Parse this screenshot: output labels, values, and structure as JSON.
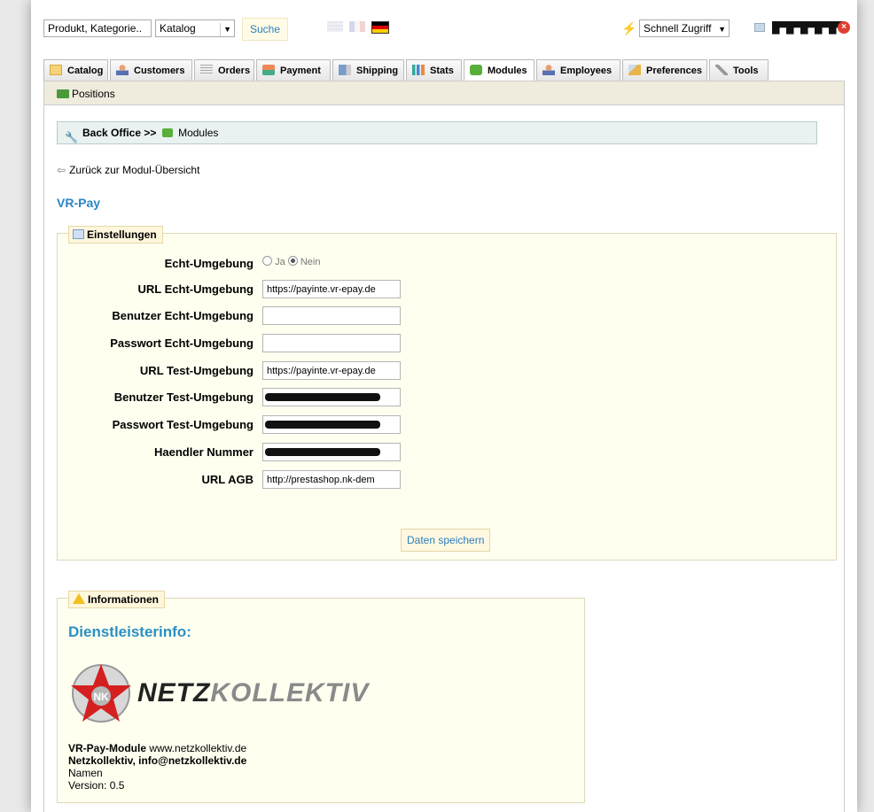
{
  "topbar": {
    "search_value": "Produkt, Kategorie..",
    "category_selected": "Katalog",
    "search_button": "Suche",
    "quick_access": "Schnell Zugriff",
    "flags": [
      "uk-flag",
      "fr-flag",
      "de-flag"
    ]
  },
  "tabs": [
    {
      "label": "Catalog",
      "icon": "folder-icon"
    },
    {
      "label": "Customers",
      "icon": "customers-icon"
    },
    {
      "label": "Orders",
      "icon": "orders-icon"
    },
    {
      "label": "Payment",
      "icon": "payment-icon"
    },
    {
      "label": "Shipping",
      "icon": "truck-icon"
    },
    {
      "label": "Stats",
      "icon": "stats-icon"
    },
    {
      "label": "Modules",
      "icon": "puzzle-icon",
      "active": true
    },
    {
      "label": "Employees",
      "icon": "employees-icon"
    },
    {
      "label": "Preferences",
      "icon": "preferences-icon"
    },
    {
      "label": "Tools",
      "icon": "wrench-icon"
    }
  ],
  "subbar": {
    "positions": "Positions"
  },
  "breadcrumb": {
    "back_office": "Back Office",
    "separator": ">>",
    "current": "Modules"
  },
  "back_link": "Zurück zur Modul-Übersicht",
  "module_title": "VR-Pay",
  "settings": {
    "legend": "Einstellungen",
    "fields": [
      {
        "label": "Echt-Umgebung",
        "type": "radio",
        "options": [
          "Ja",
          "Nein"
        ],
        "selected": "Nein"
      },
      {
        "label": "URL Echt-Umgebung",
        "value": "https://payinte.vr-epay.de"
      },
      {
        "label": "Benutzer Echt-Umgebung",
        "value": ""
      },
      {
        "label": "Passwort Echt-Umgebung",
        "value": ""
      },
      {
        "label": "URL Test-Umgebung",
        "value": "https://payinte.vr-epay.de"
      },
      {
        "label": "Benutzer Test-Umgebung",
        "redacted": true
      },
      {
        "label": "Passwort Test-Umgebung",
        "redacted": true
      },
      {
        "label": "Haendler Nummer",
        "redacted": true
      },
      {
        "label": "URL AGB",
        "value": "http://prestashop.nk-dem"
      }
    ],
    "save_button": "Daten speichern"
  },
  "info": {
    "legend": "Informationen",
    "provider_title": "Dienstleisterinfo:",
    "logo_text_a": "NETZ",
    "logo_text_b": "KOLLEKTIV",
    "line1_bold": "VR-Pay-Module",
    "line1_rest": " www.netzkollektiv.de",
    "line2": "Netzkollektiv, info@netzkollektiv.de",
    "line3": "Namen",
    "line4": "Version: 0.5"
  },
  "colors": {
    "link_blue": "#2a84c4",
    "panel_bg": "#fffff0",
    "legend_bg": "#fff7dd"
  }
}
